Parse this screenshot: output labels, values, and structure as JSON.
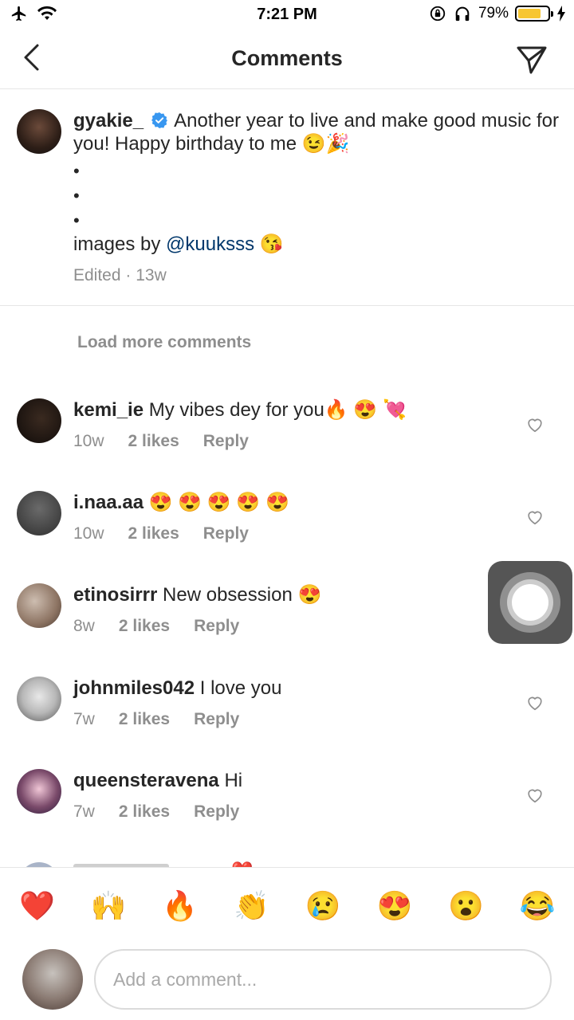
{
  "status_bar": {
    "time": "7:21 PM",
    "battery_text": "79%",
    "battery_level": 0.79,
    "icons": [
      "airplane-icon",
      "wifi-icon",
      "orientation-lock-icon",
      "headphones-icon",
      "battery-icon",
      "charging-icon"
    ]
  },
  "header": {
    "title": "Comments",
    "back_icon": "chevron-left-icon",
    "share_icon": "direct-message-icon"
  },
  "caption": {
    "username": "gyakie_",
    "verified": true,
    "text_line1": "Another year to live and make good music for you! Happy birthday to me 😉🎉",
    "bullets": [
      "•",
      "•",
      "•"
    ],
    "images_by_prefix": "images by ",
    "mention": "@kuuksss",
    "images_by_suffix": " 😘",
    "meta": "Edited · 13w"
  },
  "load_more": "Load more comments",
  "comments": [
    {
      "username": "kemi_ie",
      "text": "My vibes dey for you🔥 😍 💘",
      "time": "10w",
      "likes": "2 likes",
      "reply": "Reply"
    },
    {
      "username": "i.naa.aa",
      "text": "😍 😍 😍 😍 😍",
      "time": "10w",
      "likes": "2 likes",
      "reply": "Reply"
    },
    {
      "username": "etinosirrr",
      "text": "New obsession 😍",
      "time": "8w",
      "likes": "2 likes",
      "reply": "Reply"
    },
    {
      "username": "johnmiles042",
      "text": "I love you",
      "time": "7w",
      "likes": "2 likes",
      "reply": "Reply"
    },
    {
      "username": "queensteravena",
      "text": "Hi",
      "time": "7w",
      "likes": "2 likes",
      "reply": "Reply"
    }
  ],
  "partial_emoji": "❤️",
  "quick_reactions": [
    "❤️",
    "🙌",
    "🔥",
    "👏",
    "😢",
    "😍",
    "😮",
    "😂"
  ],
  "composer": {
    "placeholder": "Add a comment..."
  },
  "colors": {
    "text": "#262626",
    "secondary": "#8e8e8e",
    "mention": "#00376b",
    "verified": "#3897f0",
    "battery": "#f7c631",
    "divider": "#e6e6e6"
  }
}
